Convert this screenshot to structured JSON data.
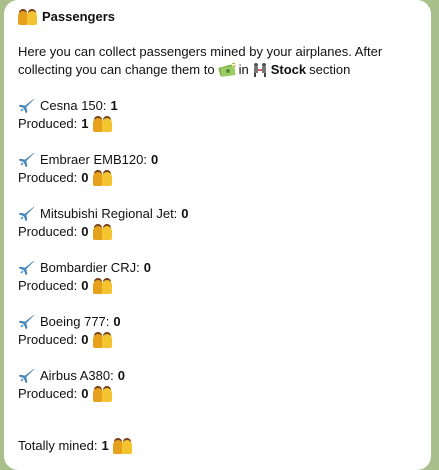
{
  "message": {
    "title": "Passengers",
    "intro_line1": "Here you can collect passengers mined by your airplanes. After",
    "intro_line2_start": "collecting you can change them to",
    "intro_line2_in": "in",
    "intro_line2_stock": "Stock",
    "intro_line2_end": "section",
    "produced_label": "Produced:",
    "planes": [
      {
        "name": "Cesna 150:",
        "count": "1",
        "produced": "1"
      },
      {
        "name": "Embraer EMB120:",
        "count": "0",
        "produced": "0"
      },
      {
        "name": "Mitsubishi Regional Jet:",
        "count": "0",
        "produced": "0"
      },
      {
        "name": "Bombardier CRJ:",
        "count": "0",
        "produced": "0"
      },
      {
        "name": "Boeing 777:",
        "count": "0",
        "produced": "0"
      },
      {
        "name": "Airbus A380:",
        "count": "0",
        "produced": "0"
      }
    ],
    "total_label": "Totally mined:",
    "total_value": "1"
  },
  "icons": {
    "passengers": "passengers-emoji-icon",
    "plane": "airplane-emoji-icon",
    "money": "money-emoji-icon",
    "stock": "stock-emoji-icon"
  },
  "colors": {
    "background": "#a9c08c",
    "bubble": "#ffffff",
    "plane": "#4a90c8"
  }
}
